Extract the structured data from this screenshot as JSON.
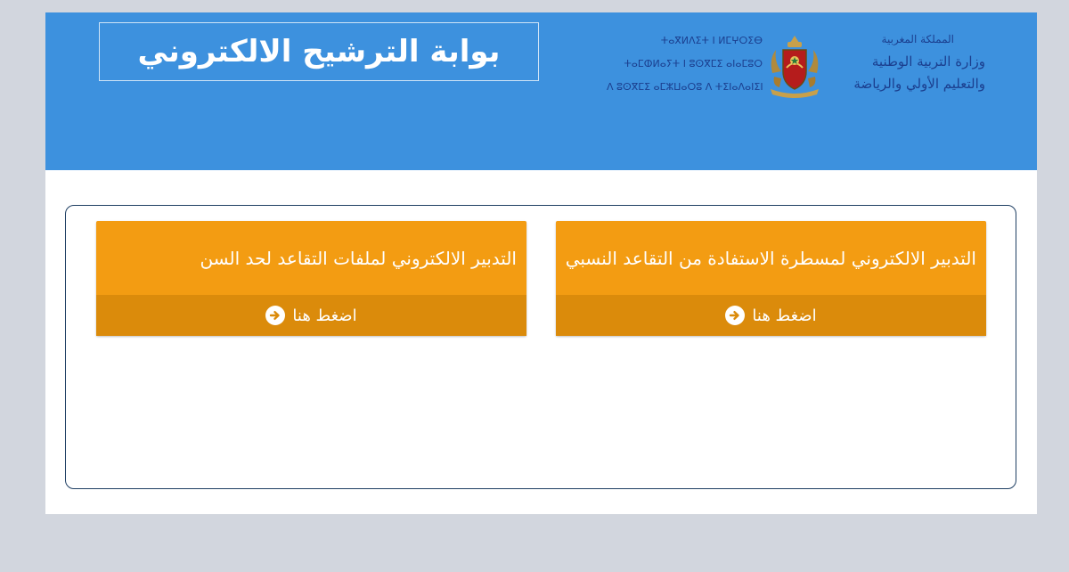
{
  "header": {
    "portal_title": "بوابة الترشيح الالكتروني",
    "ministry_ar": {
      "line1": "المملكة المغربية",
      "line2": "وزارة التربية الوطنية",
      "line3": "والتعليم الأولي والرياضة"
    },
    "ministry_tfng": {
      "line1": "ⵜⴰⴳⵍⴷⵉⵜ ⵏ ⵍⵎⵖⵔⵉⴱ",
      "line2": "ⵜⴰⵎⵀⵍⴰⵢⵜ ⵏ ⵓⵙⴳⵎⵉ ⴰⵏⴰⵎⵓⵔ",
      "line3": "ⴷ ⵓⵙⴳⵎⵉ ⴰⵎⵣⵡⴰⵔⵓ ⴷ ⵜⵉⵏⴰⴷⴰⵏⵉⵏ"
    },
    "colors": {
      "bar": "#3d91de",
      "text": "#ffffff",
      "logo_text": "#1b3f8f"
    }
  },
  "cards": [
    {
      "title": "التدبير الالكتروني لملفات التقاعد لحد السن",
      "button_label": "اضغط هنا",
      "icon": "circle-arrow-right-icon"
    },
    {
      "title": "التدبير الالكتروني لمسطرة الاستفادة من التقاعد النسبي",
      "button_label": "اضغط هنا",
      "icon": "circle-arrow-right-icon"
    }
  ],
  "colors": {
    "page_background": "#d2d6de",
    "card": "#f39c12",
    "card_footer": "#db8b0b",
    "panel_border": "#1f3f63"
  }
}
